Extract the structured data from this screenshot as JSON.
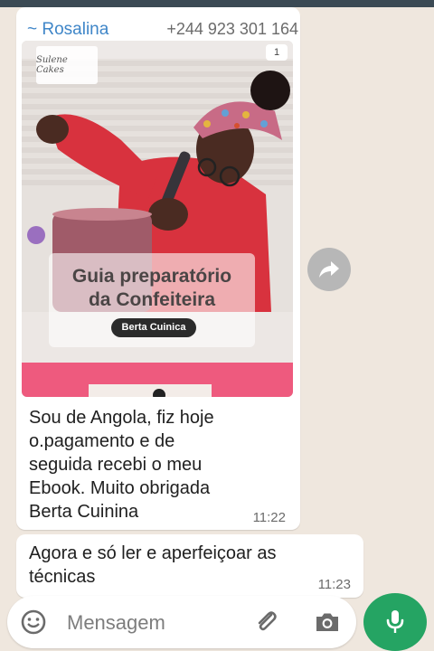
{
  "conversation": {
    "message1": {
      "sender_name": "~ Rosalina",
      "sender_phone": "+244 923 301 164",
      "media": {
        "page_count": "1",
        "logo_text": "Sulene Cakes",
        "title_line1": "Guia preparatório",
        "title_line2": "da Confeiteira",
        "author": "Berta Cuinica"
      },
      "text_line1": "Sou de Angola, fiz hoje",
      "text_line2": "o.pagamento e de",
      "text_line3": "seguida recebi o meu",
      "text_line4": "Ebook. Muito obrigada",
      "text_line5": "Berta Cuinina",
      "time": "11:22"
    },
    "message2": {
      "text_line1": "Agora e só ler e aperfeiçoar as",
      "text_line2": "técnicas",
      "time": "11:23"
    }
  },
  "composer": {
    "placeholder": "Mensagem"
  },
  "icons": {
    "forward": "forward-icon",
    "emoji": "emoji-icon",
    "attach": "paperclip-icon",
    "camera": "camera-icon",
    "mic": "microphone-icon"
  },
  "colors": {
    "accent": "#25a463",
    "sender": "#3f86c8",
    "chat_bg": "#efe7de"
  }
}
